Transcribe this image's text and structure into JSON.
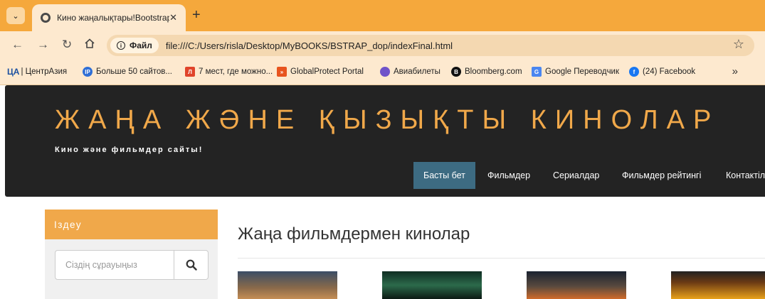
{
  "browser": {
    "tab_title": "Кино жаңалықтары!Bootstrap",
    "tab_close": "✕",
    "new_tab": "+",
    "info_chip": "Файл",
    "url": "file:///C:/Users/risla/Desktop/MyBOOKS/BSTRAP_dop/indexFinal.html",
    "bookmarks": [
      {
        "label": "| ЦентрАзия",
        "icon": "ЦА",
        "color": "#1a4fa0"
      },
      {
        "label": "Больше 50 сайтов...",
        "icon": "IP",
        "color": "#2f6fd6"
      },
      {
        "label": "7 мест, где можно...",
        "icon": "Л",
        "color": "#e0442a"
      },
      {
        "label": "GlobalProtect Portal",
        "icon": "»",
        "color": "#e8541e"
      },
      {
        "label": "Авиабилеты",
        "icon": "",
        "color": "#6f53c9"
      },
      {
        "label": "Bloomberg.com",
        "icon": "B",
        "color": "#111111"
      },
      {
        "label": "Google Переводчик",
        "icon": "G",
        "color": "#4a86f0"
      },
      {
        "label": "(24) Facebook",
        "icon": "f",
        "color": "#1877f2"
      }
    ],
    "more": "»"
  },
  "site": {
    "title": "ЖАҢА ЖӘНЕ ҚЫЗЫҚТЫ КИНОЛАР",
    "subtitle": "Кино және фильмдер сайты!",
    "nav": [
      "Басты бет",
      "Фильмдер",
      "Сериалдар",
      "Фильмдер рейтингі",
      "Контактілер"
    ]
  },
  "sidebar": {
    "heading": "Іздеу",
    "search_placeholder": "Сіздің сұрауыңыз"
  },
  "main": {
    "heading": "Жаңа фильмдермен кинолар"
  },
  "colors": {
    "accent": "#f0a84a",
    "header_bg": "#232323",
    "nav_active": "#3d6b82",
    "browser_frame": "#f5a83c"
  }
}
